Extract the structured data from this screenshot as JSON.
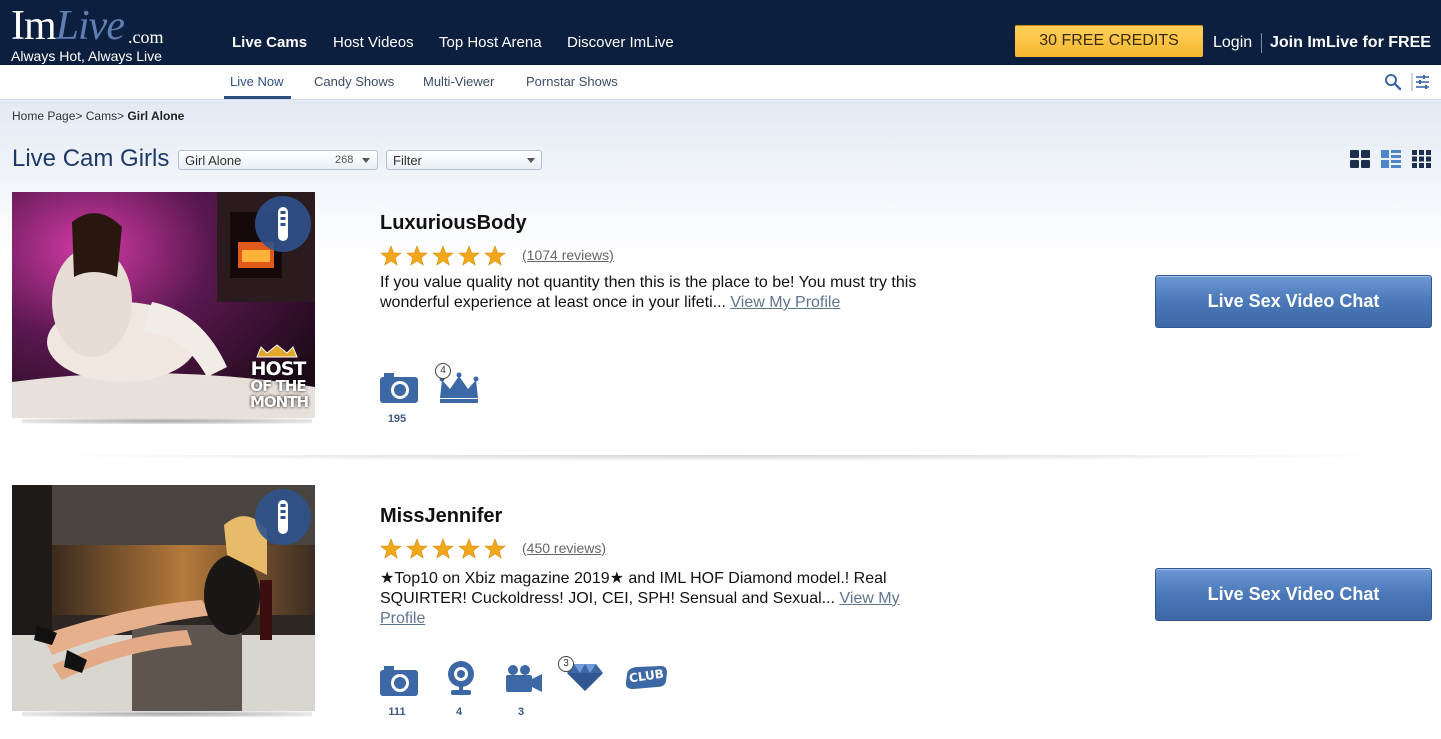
{
  "brand": {
    "logo_im": "Im",
    "logo_live": "Live",
    "logo_com": ".com",
    "tagline": "Always Hot, Always Live"
  },
  "main_nav": {
    "items": [
      "Live Cams",
      "Host Videos",
      "Top Host Arena",
      "Discover ImLive"
    ]
  },
  "header": {
    "credits_label": "30 FREE CREDITS",
    "login_label": "Login",
    "join_label": "Join ImLive for FREE"
  },
  "sub_nav": {
    "items": [
      "Live Now",
      "Candy Shows",
      "Multi-Viewer",
      "Pornstar Shows"
    ]
  },
  "breadcrumb": {
    "home": "Home Page>",
    "cams": "Cams>",
    "current": "Girl Alone"
  },
  "page": {
    "title": "Live Cam Girls",
    "category_dropdown": {
      "label": "Girl Alone",
      "count": "268"
    },
    "filter_dropdown": {
      "label": "Filter"
    }
  },
  "colors": {
    "header_bg": "#0d1f3f",
    "accent_blue": "#2d4f7f",
    "credits_yellow": "#f5b62e",
    "star_gold": "#f3a81c",
    "button_blue": "#4a78b8"
  },
  "models": [
    {
      "name": "LuxuriousBody",
      "rating_stars": 5,
      "reviews": "(1074 reviews)",
      "description": "If you value quality not quantity then this is the place to be! You must try this wonderful experience at least once in your lifeti...",
      "profile_link": "View My Profile",
      "badge_icon": "toy-icon",
      "host_of_month": {
        "line1": "HOST",
        "line2": "OF THE",
        "line3": "MONTH"
      },
      "cta": "Live Sex Video Chat",
      "features": [
        {
          "icon": "camera-icon",
          "count": "195"
        },
        {
          "icon": "crown-icon",
          "badge": "4"
        }
      ]
    },
    {
      "name": "MissJennifer",
      "rating_stars": 5,
      "reviews": "(450 reviews)",
      "description": "★Top10 on Xbiz magazine 2019★ and IML HOF Diamond model.! Real SQUIRTER! Cuckoldress! JOI, CEI, SPH! Sensual and Sexual...",
      "profile_link": "View My Profile",
      "badge_icon": "toy-icon",
      "cta": "Live Sex Video Chat",
      "features": [
        {
          "icon": "camera-icon",
          "count": "111"
        },
        {
          "icon": "webcam-icon",
          "count": "4"
        },
        {
          "icon": "video-camera-icon",
          "count": "3"
        },
        {
          "icon": "diamond-icon",
          "badge": "3"
        },
        {
          "icon": "club-icon",
          "label": "CLUB"
        }
      ]
    }
  ]
}
